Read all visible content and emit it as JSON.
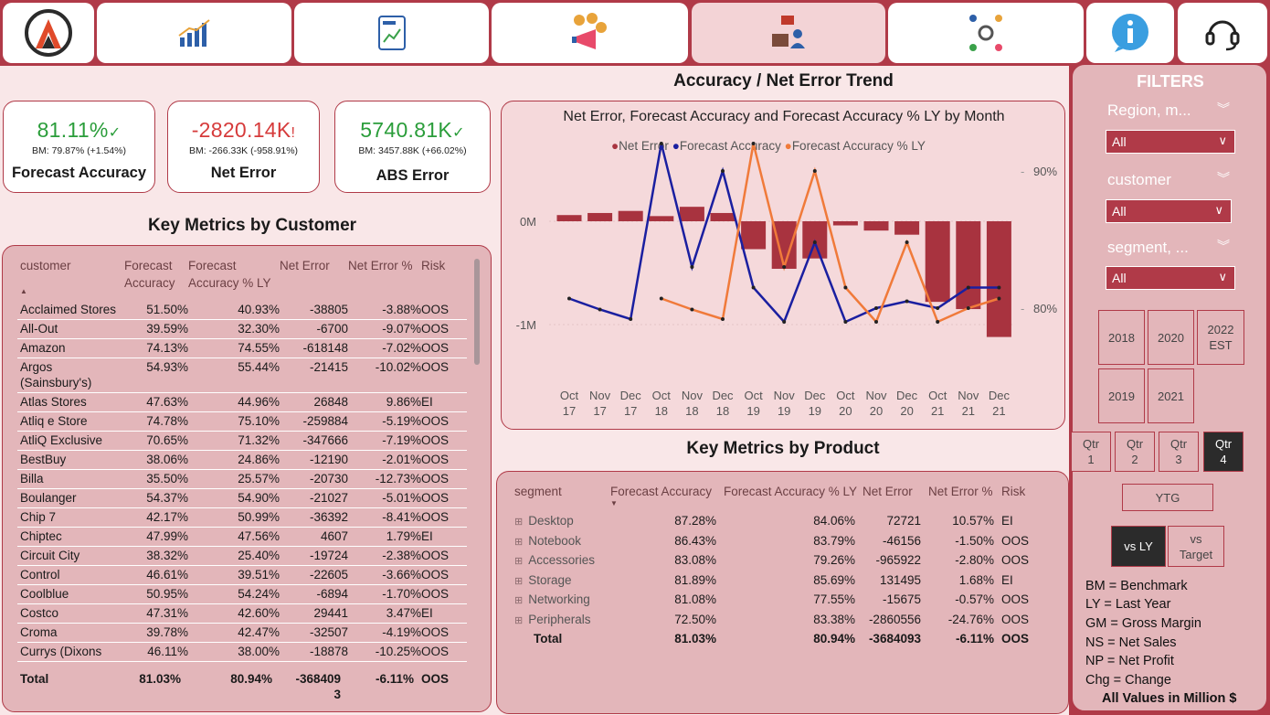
{
  "nav": {
    "tiles": [
      "logo-icon",
      "trend-chart-icon",
      "sales-report-icon",
      "marketing-megaphone-icon",
      "supply-chain-icon",
      "executive-view-icon",
      "info-icon",
      "support-headset-icon"
    ]
  },
  "kpis": [
    {
      "value": "81.11%",
      "indicator": "✓",
      "bm": "BM: 79.87% (+1.54%)",
      "label": "Forecast Accuracy",
      "color": "#2a9d3a"
    },
    {
      "value": "-2820.14K",
      "indicator": "!",
      "bm": "BM: -266.33K (-958.91%)",
      "label": "Net Error",
      "color": "#d63b3b"
    },
    {
      "value": "5740.81K",
      "indicator": "✓",
      "bm": "BM: 3457.88K (+66.02%)",
      "label": "ABS Error",
      "color": "#2a9d3a"
    }
  ],
  "customer_table": {
    "title": "Key Metrics by Customer",
    "headers": [
      "customer",
      "Forecast Accuracy",
      "Forecast Accuracy % LY",
      "Net Error",
      "Net Error %",
      "Risk"
    ],
    "rows": [
      [
        "Acclaimed Stores",
        "51.50%",
        "40.93%",
        "-38805",
        "-3.88%",
        "OOS"
      ],
      [
        "All-Out",
        "39.59%",
        "32.30%",
        "-6700",
        "-9.07%",
        "OOS"
      ],
      [
        "Amazon",
        "74.13%",
        "74.55%",
        "-618148",
        "-7.02%",
        "OOS"
      ],
      [
        "Argos (Sainsbury's)",
        "54.93%",
        "55.44%",
        "-21415",
        "-10.02%",
        "OOS"
      ],
      [
        "Atlas Stores",
        "47.63%",
        "44.96%",
        "26848",
        "9.86%",
        "EI"
      ],
      [
        "Atliq e Store",
        "74.78%",
        "75.10%",
        "-259884",
        "-5.19%",
        "OOS"
      ],
      [
        "AtliQ Exclusive",
        "70.65%",
        "71.32%",
        "-347666",
        "-7.19%",
        "OOS"
      ],
      [
        "BestBuy",
        "38.06%",
        "24.86%",
        "-12190",
        "-2.01%",
        "OOS"
      ],
      [
        "Billa",
        "35.50%",
        "25.57%",
        "-20730",
        "-12.73%",
        "OOS"
      ],
      [
        "Boulanger",
        "54.37%",
        "54.90%",
        "-21027",
        "-5.01%",
        "OOS"
      ],
      [
        "Chip 7",
        "42.17%",
        "50.99%",
        "-36392",
        "-8.41%",
        "OOS"
      ],
      [
        "Chiptec",
        "47.99%",
        "47.56%",
        "4607",
        "1.79%",
        "EI"
      ],
      [
        "Circuit City",
        "38.32%",
        "25.40%",
        "-19724",
        "-2.38%",
        "OOS"
      ],
      [
        "Control",
        "46.61%",
        "39.51%",
        "-22605",
        "-3.66%",
        "OOS"
      ],
      [
        "Coolblue",
        "50.95%",
        "54.24%",
        "-6894",
        "-1.70%",
        "OOS"
      ],
      [
        "Costco",
        "47.31%",
        "42.60%",
        "29441",
        "3.47%",
        "EI"
      ],
      [
        "Croma",
        "39.78%",
        "42.47%",
        "-32507",
        "-4.19%",
        "OOS"
      ],
      [
        "Currys (Dixons",
        "46.11%",
        "38.00%",
        "-18878",
        "-10.25%",
        "OOS"
      ]
    ],
    "total": [
      "Total",
      "81.03%",
      "80.94%",
      "-368409 3",
      "-6.11%",
      "OOS"
    ]
  },
  "trend": {
    "section_title": "Accuracy / Net Error Trend",
    "chart_title": "Net Error, Forecast Accuracy and Forecast Accuracy % LY by Month",
    "y_left_ticks": [
      "0M",
      "-1M"
    ],
    "y_right_ticks": [
      "90%",
      "80%"
    ]
  },
  "chart_data": {
    "type": "bar+line",
    "categories": [
      "Oct 17",
      "Nov 17",
      "Dec 17",
      "Oct 18",
      "Nov 18",
      "Dec 18",
      "Oct 19",
      "Nov 19",
      "Dec 19",
      "Oct 20",
      "Nov 20",
      "Dec 20",
      "Oct 21",
      "Nov 21",
      "Dec 21"
    ],
    "series": [
      {
        "name": "Net Error",
        "type": "bar",
        "axis": "left",
        "color": "#a8333f",
        "values": [
          0.06,
          0.08,
          0.1,
          0.05,
          0.14,
          0.08,
          -0.27,
          -0.46,
          -0.36,
          -0.04,
          -0.09,
          -0.13,
          -0.78,
          -0.85,
          -1.12
        ]
      },
      {
        "name": "Forecast Accuracy",
        "type": "line",
        "axis": "right",
        "color": "#1a1fa0",
        "values": [
          80.7,
          79.9,
          79.2,
          92.0,
          83.0,
          90.0,
          81.5,
          79.0,
          84.8,
          79.0,
          80.0,
          80.5,
          80.0,
          81.5,
          81.5
        ]
      },
      {
        "name": "Forecast Accuracy % LY",
        "type": "line",
        "axis": "right",
        "color": "#f07a3a",
        "values": [
          null,
          null,
          null,
          80.7,
          79.9,
          79.2,
          92.0,
          83.0,
          90.0,
          81.5,
          79.0,
          84.8,
          79.0,
          80.0,
          80.7
        ]
      }
    ],
    "y_left_range": [
      -1.12,
      0.14
    ],
    "y_right_range": [
      78.5,
      92.5
    ]
  },
  "product_table": {
    "title": "Key Metrics by Product",
    "headers": [
      "segment",
      "Forecast Accuracy",
      "Forecast Accuracy % LY",
      "Net Error",
      "Net Error %",
      "Risk"
    ],
    "rows": [
      [
        "Desktop",
        "87.28%",
        "84.06%",
        "72721",
        "10.57%",
        "EI"
      ],
      [
        "Notebook",
        "86.43%",
        "83.79%",
        "-46156",
        "-1.50%",
        "OOS"
      ],
      [
        "Accessories",
        "83.08%",
        "79.26%",
        "-965922",
        "-2.80%",
        "OOS"
      ],
      [
        "Storage",
        "81.89%",
        "85.69%",
        "131495",
        "1.68%",
        "EI"
      ],
      [
        "Networking",
        "81.08%",
        "77.55%",
        "-15675",
        "-0.57%",
        "OOS"
      ],
      [
        "Peripherals",
        "72.50%",
        "83.38%",
        "-2860556",
        "-24.76%",
        "OOS"
      ]
    ],
    "total": [
      "Total",
      "81.03%",
      "80.94%",
      "-3684093",
      "-6.11%",
      "OOS"
    ]
  },
  "filters": {
    "title": "FILTERS",
    "slicers": [
      {
        "label": "Region, m...",
        "value": "All"
      },
      {
        "label": "customer",
        "value": "All"
      },
      {
        "label": "segment, ...",
        "value": "All"
      }
    ],
    "years": [
      "2018",
      "2020",
      "2022 EST",
      "2019",
      "2021"
    ],
    "quarters": [
      "Qtr 1",
      "Qtr 2",
      "Qtr 3",
      "Qtr 4"
    ],
    "ytg": "YTG",
    "compare": [
      "vs LY",
      "vs Target"
    ],
    "glossary": [
      "BM = Benchmark",
      "LY = Last Year",
      "GM = Gross Margin",
      "NS = Net Sales",
      "NP = Net Profit",
      "Chg = Change"
    ],
    "footer": "All Values in Million $"
  }
}
